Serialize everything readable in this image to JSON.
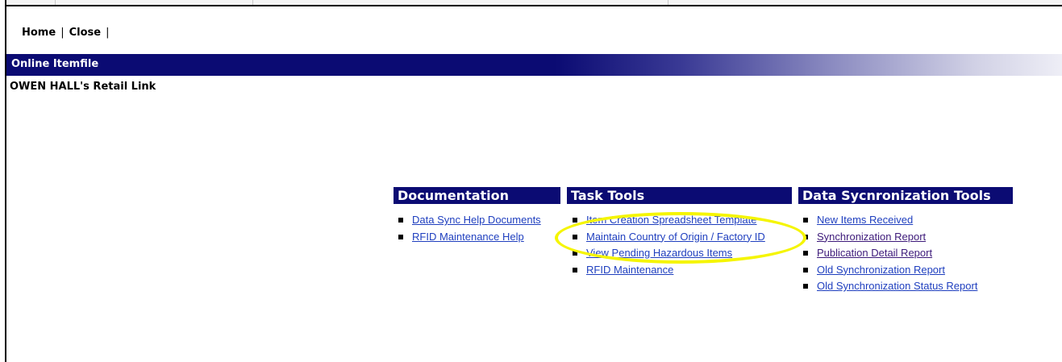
{
  "topnav": {
    "home": "Home",
    "close": "Close",
    "separator": "|"
  },
  "banner": {
    "title": "Online Itemfile"
  },
  "welcome": "OWEN HALL's Retail Link",
  "panels": {
    "documentation": {
      "title": "Documentation",
      "links": [
        "Data Sync Help Documents",
        "RFID Maintenance Help"
      ]
    },
    "task_tools": {
      "title": "Task Tools",
      "links": [
        "Item Creation Spreadsheet Template",
        "Maintain Country of Origin / Factory ID",
        "View Pending Hazardous Items",
        "RFID Maintenance"
      ]
    },
    "data_sync": {
      "title": "Data Sycnronization Tools",
      "links": [
        "New Items Received",
        "Synchronization Report",
        "Publication Detail Report",
        "Old Synchronization Report",
        "Old Synchronization Status Report"
      ]
    }
  },
  "colors": {
    "banner": "#0b0b73",
    "link": "#1f3fbf",
    "visited_link": "#3d1a7a",
    "highlight": "#f5f500"
  }
}
